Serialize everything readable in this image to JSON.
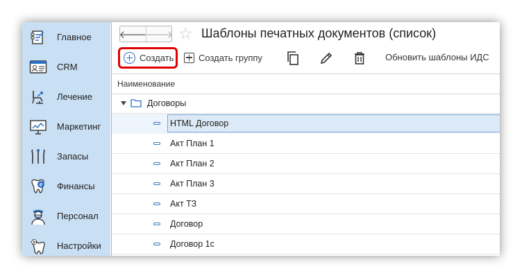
{
  "sidebar": {
    "items": [
      {
        "label": "Главное",
        "icon": "document-list-icon"
      },
      {
        "label": "CRM",
        "icon": "id-card-icon"
      },
      {
        "label": "Лечение",
        "icon": "dental-chair-icon"
      },
      {
        "label": "Маркетинг",
        "icon": "presentation-board-icon"
      },
      {
        "label": "Запасы",
        "icon": "dental-tools-icon"
      },
      {
        "label": "Финансы",
        "icon": "tooth-coin-icon"
      },
      {
        "label": "Персонал",
        "icon": "doctor-icon"
      },
      {
        "label": "Настройки",
        "icon": "tooth-gear-icon"
      }
    ]
  },
  "header": {
    "back": "🡐",
    "forward": "🡒",
    "star": "☆",
    "title": "Шаблоны печатных документов (список)"
  },
  "toolbar": {
    "create_label": "Создать",
    "create_group_label": "Создать группу",
    "update_label": "Обновить шаблоны ИДС"
  },
  "table": {
    "column_header": "Наименование",
    "group": {
      "label": "Договоры",
      "expanded": true
    },
    "rows": [
      {
        "label": "HTML Договор",
        "selected": true
      },
      {
        "label": "Акт План 1"
      },
      {
        "label": "Акт План 2"
      },
      {
        "label": "Акт План 3"
      },
      {
        "label": "Акт ТЗ"
      },
      {
        "label": "Договор"
      },
      {
        "label": "Договор 1с"
      }
    ]
  },
  "colors": {
    "sidebar_bg": "#c9dff4",
    "accent": "#2a6fc4",
    "highlight_border": "#e00000",
    "selection": "#dce9f6"
  }
}
